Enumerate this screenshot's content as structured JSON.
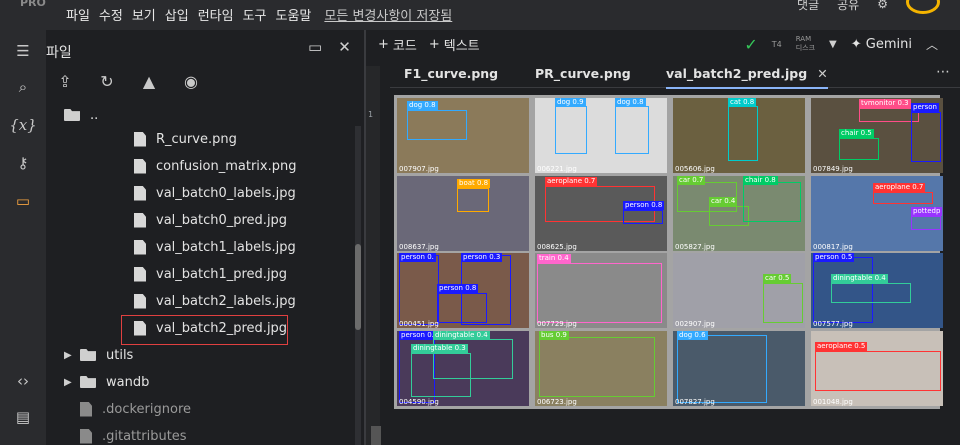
{
  "app": {
    "logo_text": "PRO",
    "menu": [
      "파일",
      "수정",
      "보기",
      "삽입",
      "런타임",
      "도구",
      "도움말"
    ],
    "saved_status": "모든 변경사항이 저장됨",
    "top_right": [
      "댓글",
      "공유"
    ]
  },
  "file_panel": {
    "title": "파일",
    "parent_dir": "..",
    "items": [
      {
        "type": "file",
        "name": "R_curve.png"
      },
      {
        "type": "file",
        "name": "confusion_matrix.png"
      },
      {
        "type": "file",
        "name": "val_batch0_labels.jpg"
      },
      {
        "type": "file",
        "name": "val_batch0_pred.jpg"
      },
      {
        "type": "file",
        "name": "val_batch1_labels.jpg"
      },
      {
        "type": "file",
        "name": "val_batch1_pred.jpg"
      },
      {
        "type": "file",
        "name": "val_batch2_labels.jpg"
      },
      {
        "type": "file",
        "name": "val_batch2_pred.jpg",
        "selected": true
      },
      {
        "type": "folder",
        "name": "utils"
      },
      {
        "type": "folder",
        "name": "wandb"
      },
      {
        "type": "file",
        "name": ".dockerignore"
      },
      {
        "type": "file",
        "name": ".gitattributes"
      }
    ]
  },
  "toolbar": {
    "add_code": "코드",
    "add_text": "텍스트",
    "runtime": "T4",
    "ram_label": "RAM",
    "disk_label": "디스크",
    "gemini": "Gemini"
  },
  "tabs": [
    {
      "label": "F1_curve.png"
    },
    {
      "label": "PR_curve.png"
    },
    {
      "label": "val_batch2_pred.jpg",
      "active": true
    }
  ],
  "gutter_line": "1",
  "grid": {
    "cells": [
      {
        "file": "007907.jpg",
        "bg": "#8b7a5a",
        "tags": [
          {
            "t": "dog 0.8",
            "c": "#33aaff"
          }
        ]
      },
      {
        "file": "006221.jpg",
        "bg": "#dcdcdc",
        "tags": [
          {
            "t": "dog 0.9",
            "c": "#33aaff"
          },
          {
            "t": "dog 0.8",
            "c": "#33aaff"
          }
        ]
      },
      {
        "file": "005606.jpg",
        "bg": "#6b6040",
        "tags": [
          {
            "t": "cat 0.8",
            "c": "#00cccc"
          }
        ]
      },
      {
        "file": "007849.jpg",
        "bg": "#5a5040",
        "tags": [
          {
            "t": "tvmonitor 0.3",
            "c": "#ff4d88"
          },
          {
            "t": "chair 0.5",
            "c": "#00cc66"
          },
          {
            "t": "person",
            "c": "#1a1aff"
          }
        ]
      },
      {
        "file": "008637.jpg",
        "bg": "#6a6878",
        "tags": [
          {
            "t": "boat 0.8",
            "c": "#ffaa00"
          }
        ]
      },
      {
        "file": "008625.jpg",
        "bg": "#5a5a5a",
        "tags": [
          {
            "t": "aeroplane 0.7",
            "c": "#ff3333"
          },
          {
            "t": "person 0.8",
            "c": "#1a1aff"
          }
        ]
      },
      {
        "file": "005827.jpg",
        "bg": "#7a8a70",
        "tags": [
          {
            "t": "car 0.7",
            "c": "#66cc33"
          },
          {
            "t": "car 0.4",
            "c": "#66cc33"
          },
          {
            "t": "chair 0.8",
            "c": "#00cc66"
          }
        ]
      },
      {
        "file": "000817.jpg",
        "bg": "#5577aa",
        "tags": [
          {
            "t": "aeroplane 0.7",
            "c": "#ff3333"
          },
          {
            "t": "pottedp",
            "c": "#9933ff"
          }
        ]
      },
      {
        "file": "000451.jpg",
        "bg": "#7a5a4a",
        "tags": [
          {
            "t": "person 0.",
            "c": "#1a1aff"
          },
          {
            "t": "person 0.3",
            "c": "#1a1aff"
          },
          {
            "t": "person 0.8",
            "c": "#1a1aff"
          }
        ]
      },
      {
        "file": "007729.jpg",
        "bg": "#8a8a8a",
        "tags": [
          {
            "t": "train 0.4",
            "c": "#ff66cc"
          }
        ]
      },
      {
        "file": "002907.jpg",
        "bg": "#a0a0a8",
        "tags": [
          {
            "t": "car 0.5",
            "c": "#66cc33"
          }
        ]
      },
      {
        "file": "007577.jpg",
        "bg": "#335588",
        "tags": [
          {
            "t": "person 0.5",
            "c": "#1a1aff"
          },
          {
            "t": "diningtable 0.4",
            "c": "#33cc99"
          }
        ]
      },
      {
        "file": "004590.jpg",
        "bg": "#4a3a5a",
        "tags": [
          {
            "t": "person 0.7",
            "c": "#1a1aff"
          },
          {
            "t": "diningtable 0.4",
            "c": "#33cc99"
          },
          {
            "t": "diningtable 0.3",
            "c": "#33cc99"
          }
        ]
      },
      {
        "file": "006723.jpg",
        "bg": "#8a8060",
        "tags": [
          {
            "t": "bus 0.9",
            "c": "#66cc33"
          }
        ]
      },
      {
        "file": "007827.jpg",
        "bg": "#4a5a6a",
        "tags": [
          {
            "t": "dog 0.6",
            "c": "#33aaff"
          }
        ]
      },
      {
        "file": "001048.jpg",
        "bg": "#c8c0b8",
        "tags": [
          {
            "t": "aeroplane 0.5",
            "c": "#ff3333"
          }
        ]
      }
    ]
  },
  "colors": {
    "accent": "#8ab4f8",
    "selection_outline": "#e04040",
    "status_ok": "#35c759"
  }
}
